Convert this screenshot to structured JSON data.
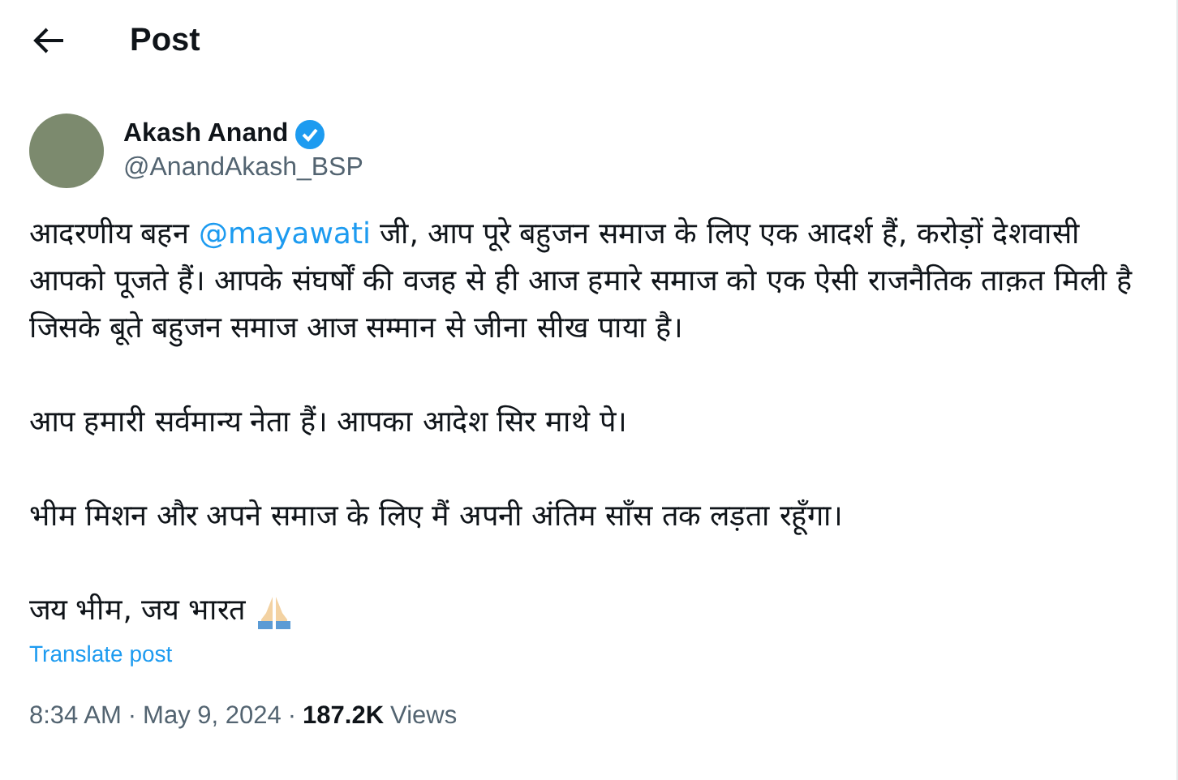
{
  "header": {
    "title": "Post"
  },
  "author": {
    "name": "Akash Anand",
    "verified": true,
    "handle": "@AnandAkash_BSP"
  },
  "body": [
    {
      "kind": "mention",
      "before": "आदरणीय बहन ",
      "mention": "@mayawati",
      "after": " जी, आप पूरे बहुजन समाज के लिए एक आदर्श हैं, करोड़ों देशवासी आपको पूजते हैं। आपके संघर्षों की वजह से ही आज हमारे समाज को एक ऐसी राजनैतिक ताक़त मिली है जिसके बूते बहुजन समाज आज सम्मान से जीना सीख पाया है।"
    },
    {
      "kind": "plain",
      "text": "आप हमारी सर्वमान्य नेता हैं। आपका आदेश सिर माथे पे।"
    },
    {
      "kind": "plain",
      "text": "भीम मिशन और अपने समाज के लिए मैं अपनी अंतिम साँस तक लड़ता रहूँगा।"
    },
    {
      "kind": "emoji",
      "text": "जय भीम, जय भारत"
    }
  ],
  "translate_link": "Translate post",
  "meta": {
    "time": "8:34 AM",
    "separator_1": "·",
    "date": "May 9, 2024",
    "separator_2": "·",
    "views_count": "187.2K",
    "views_label": "Views"
  }
}
